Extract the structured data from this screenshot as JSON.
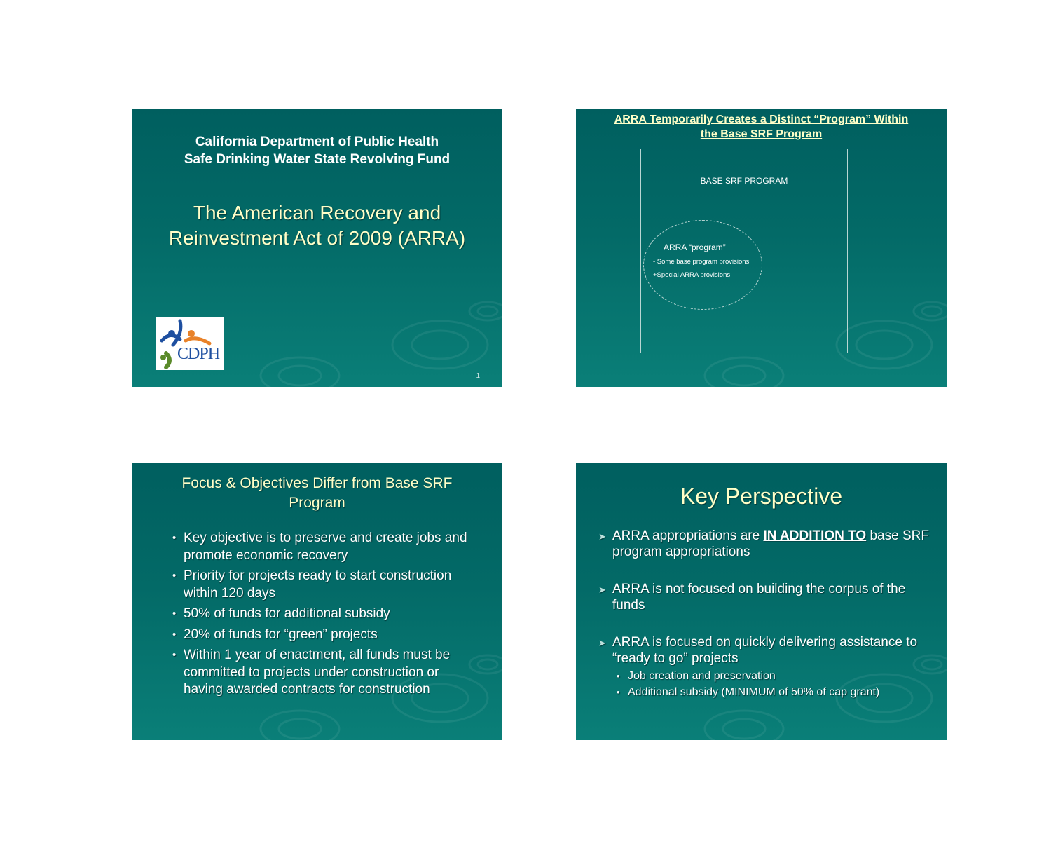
{
  "slides": {
    "s1": {
      "org_line1": "California Department of Public Health",
      "org_line2": "Safe Drinking Water State Revolving Fund",
      "title_line1": "The American Recovery and",
      "title_line2": "Reinvestment Act of 2009 (ARRA)",
      "logo_text": "CDPH",
      "page_number": "1"
    },
    "s2": {
      "title_line1": "ARRA Temporarily Creates a Distinct “Program” Within",
      "title_line2": "the Base SRF Program",
      "base_label": "BASE SRF PROGRAM",
      "ellipse_title": "ARRA “program”",
      "ellipse_line1": "- Some base program provisions",
      "ellipse_line2": "+Special ARRA provisions"
    },
    "s3": {
      "title_line1": "Focus & Objectives Differ from Base SRF",
      "title_line2": "Program",
      "bullets": [
        "Key objective is to preserve and create jobs and promote economic recovery",
        "Priority for projects ready to start construction within 120 days",
        "50% of funds for additional subsidy",
        "20% of funds for “green” projects",
        "Within 1 year of enactment, all funds must be committed to projects under construction or having awarded contracts for construction"
      ]
    },
    "s4": {
      "title": "Key Perspective",
      "item1_pre": "ARRA appropriations are ",
      "item1_emph": "IN ADDITION TO",
      "item1_post": " base SRF program appropriations",
      "item2": "ARRA is not focused on building the corpus of the funds",
      "item3": "ARRA is focused on quickly delivering assistance to “ready to go” projects",
      "sub_items": [
        "Job creation and preservation",
        "Additional subsidy (MINIMUM of 50% of cap grant)"
      ]
    }
  },
  "colors": {
    "slide_top": "#005f5f",
    "slide_bottom": "#0a7f78",
    "title_yellow": "#ffffc8",
    "logo_blue": "#1e4fa0",
    "logo_orange": "#e8822a",
    "logo_green": "#5a8a2a"
  }
}
